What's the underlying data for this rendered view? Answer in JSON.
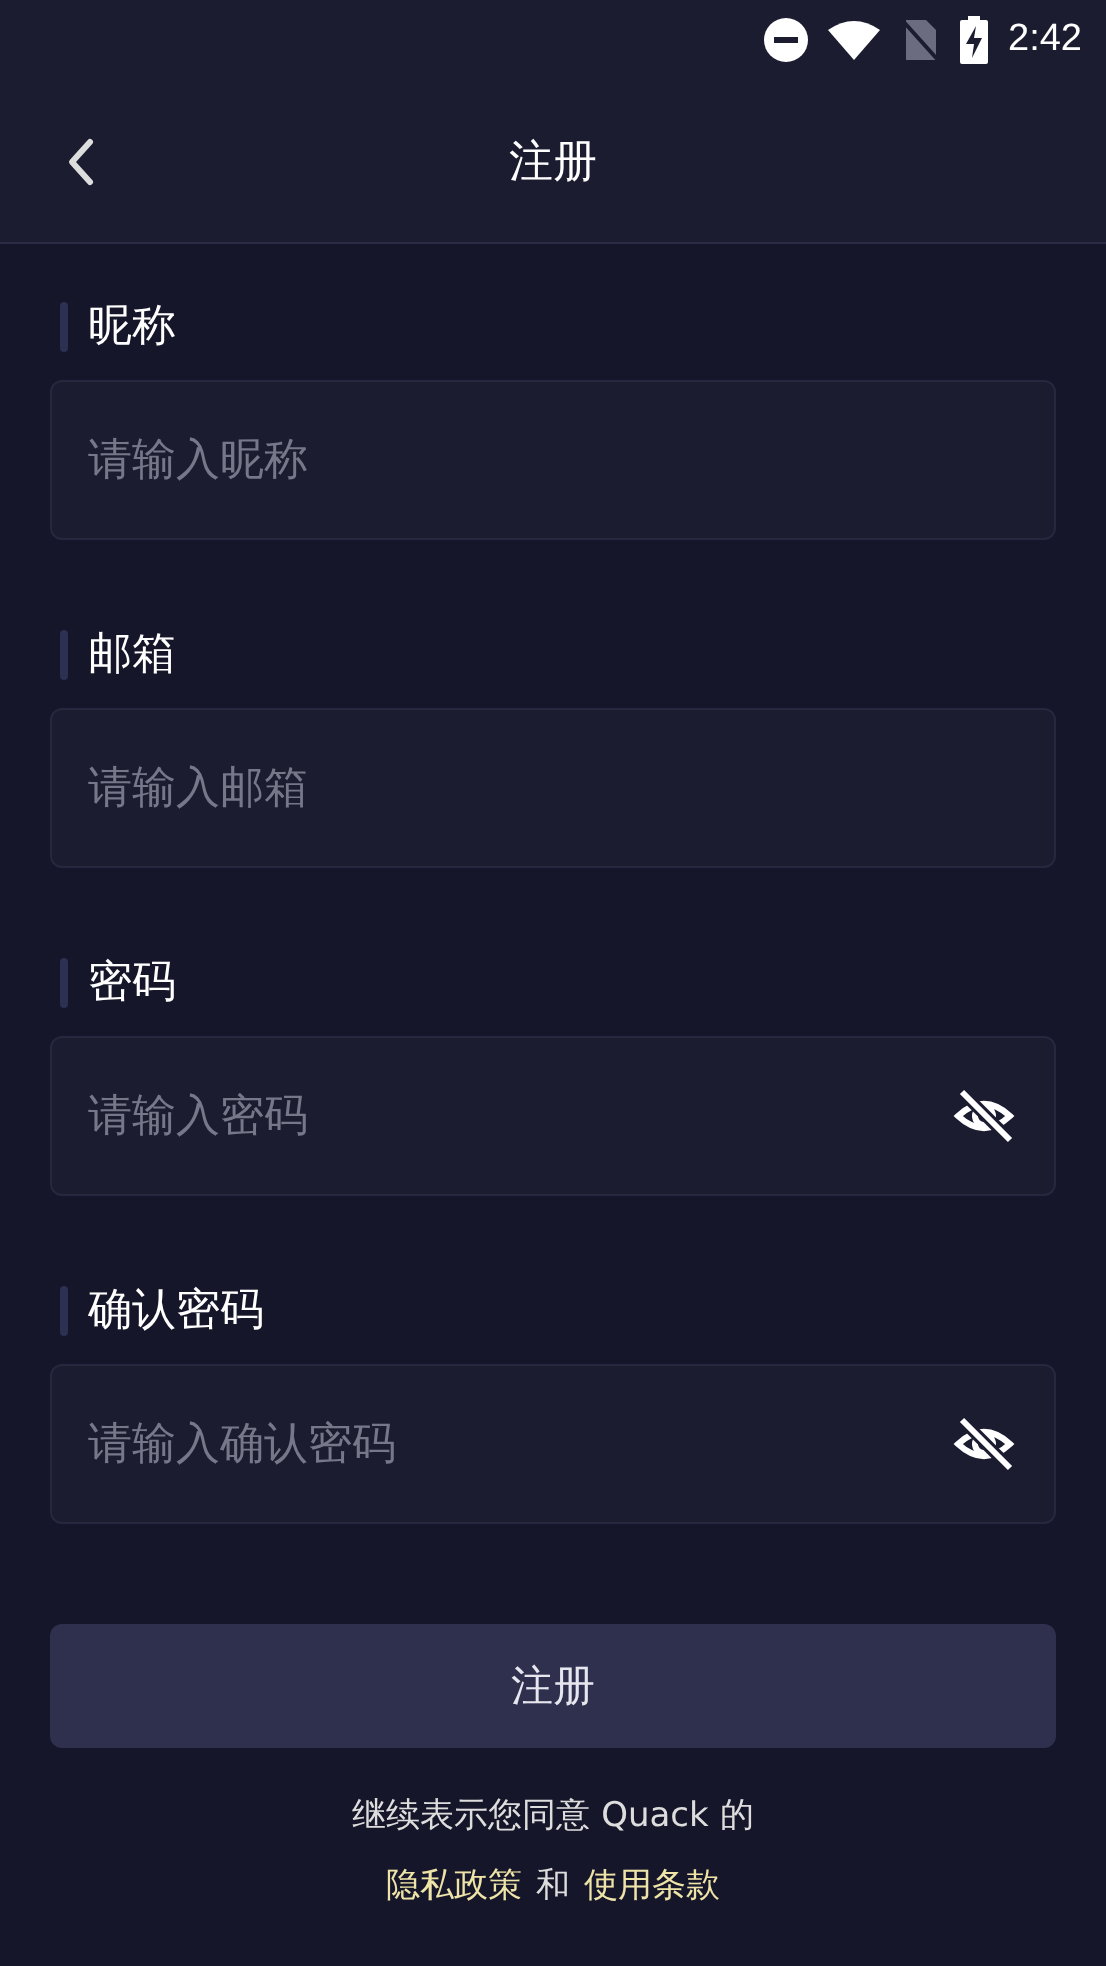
{
  "status_bar": {
    "time": "2:42"
  },
  "header": {
    "title": "注册"
  },
  "fields": [
    {
      "label": "昵称",
      "placeholder": "请输入昵称",
      "kind": "text"
    },
    {
      "label": "邮箱",
      "placeholder": "请输入邮箱",
      "kind": "text"
    },
    {
      "label": "密码",
      "placeholder": "请输入密码",
      "kind": "password",
      "hidden": true
    },
    {
      "label": "确认密码",
      "placeholder": "请输入确认密码",
      "kind": "password",
      "hidden": true
    }
  ],
  "submit_button": "注册",
  "terms": {
    "intro": "继续表示您同意 Quack 的",
    "privacy_link": "隐私政策",
    "conjunction": "和",
    "terms_link": "使用条款"
  }
}
